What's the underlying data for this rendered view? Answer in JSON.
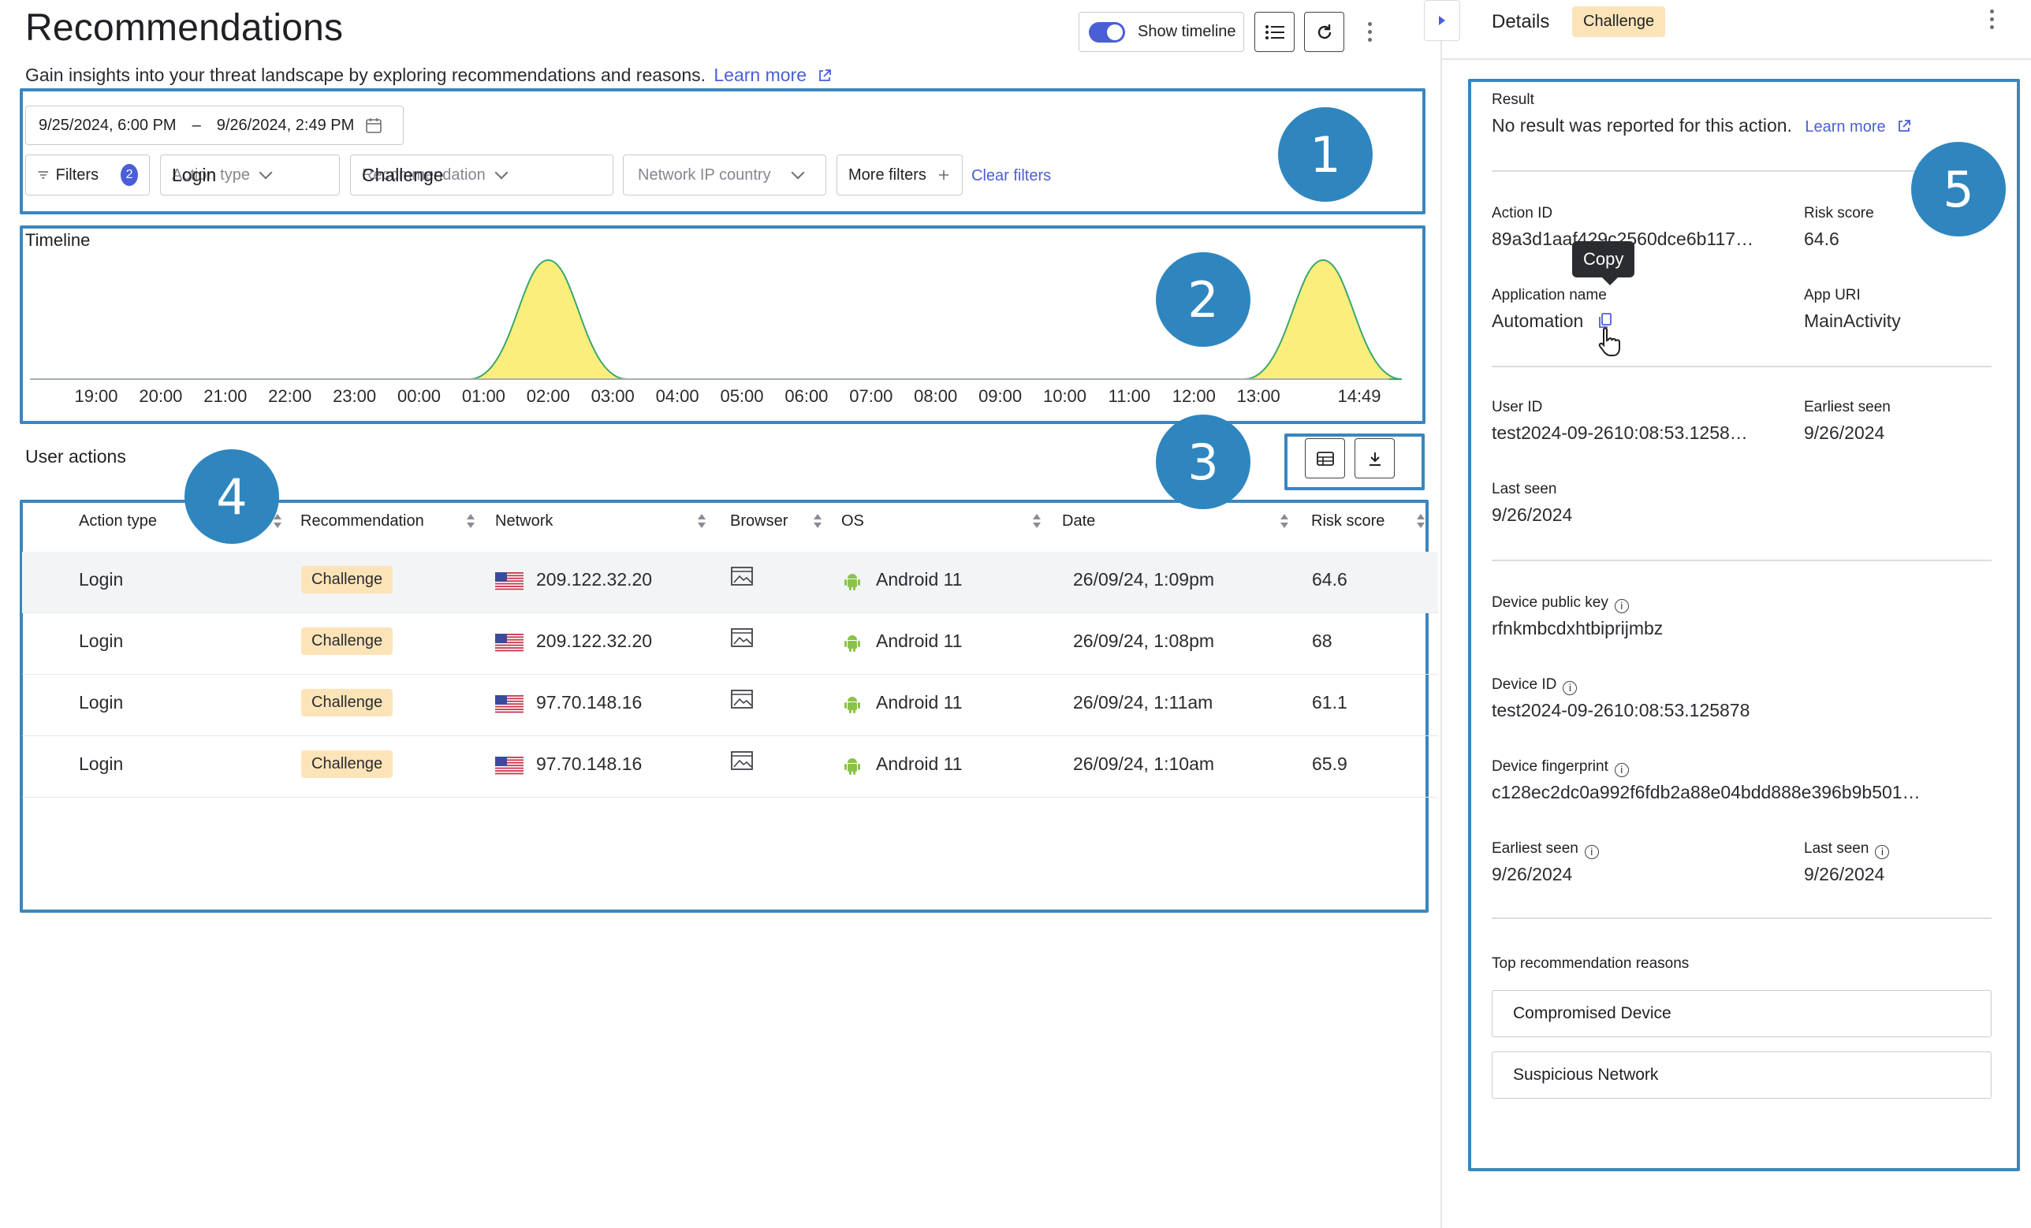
{
  "header": {
    "title": "Recommendations",
    "subtitle": "Gain insights into your threat landscape by exploring recommendations and reasons.",
    "learn_more": "Learn more",
    "show_timeline_label": "Show timeline",
    "show_timeline_on": true
  },
  "filters": {
    "date_start": "9/25/2024, 6:00 PM",
    "date_separator": "–",
    "date_end": "9/26/2024, 2:49 PM",
    "filters_label": "Filters",
    "filters_count": "2",
    "action_type_label": "Action type",
    "action_type_value": "Login",
    "recommendation_label": "Recommendation",
    "recommendation_value": "Challenge",
    "network_ip_country_label": "Network IP country",
    "more_filters_label": "More filters",
    "clear_filters_label": "Clear filters"
  },
  "timeline": {
    "title": "Timeline",
    "ticks": [
      "19:00",
      "20:00",
      "21:00",
      "22:00",
      "23:00",
      "00:00",
      "01:00",
      "02:00",
      "03:00",
      "04:00",
      "05:00",
      "06:00",
      "07:00",
      "08:00",
      "09:00",
      "10:00",
      "11:00",
      "12:00",
      "13:00",
      "14:49"
    ]
  },
  "chart_data": {
    "type": "area",
    "title": "Timeline",
    "x": [
      "19:00",
      "20:00",
      "21:00",
      "22:00",
      "23:00",
      "00:00",
      "01:00",
      "02:00",
      "03:00",
      "04:00",
      "05:00",
      "06:00",
      "07:00",
      "08:00",
      "09:00",
      "10:00",
      "11:00",
      "12:00",
      "13:00",
      "14:00",
      "14:49"
    ],
    "series": [
      {
        "values": [
          0,
          0,
          0,
          0,
          0,
          0,
          0,
          4,
          0,
          0,
          0,
          0,
          0,
          0,
          0,
          0,
          0,
          0,
          0,
          4,
          0
        ]
      }
    ],
    "grid": false,
    "fill_color": "#fcee7c",
    "line_color": "#3aa76d"
  },
  "user_actions": {
    "title": "User actions",
    "columns": [
      "Action type",
      "Recommendation",
      "Network",
      "Browser",
      "OS",
      "Date",
      "Risk score"
    ],
    "rows": [
      {
        "action": "Login",
        "recommendation": "Challenge",
        "network": "209.122.32.20",
        "os": "Android 11",
        "date": "26/09/24, 1:09pm",
        "risk": "64.6"
      },
      {
        "action": "Login",
        "recommendation": "Challenge",
        "network": "209.122.32.20",
        "os": "Android 11",
        "date": "26/09/24, 1:08pm",
        "risk": "68"
      },
      {
        "action": "Login",
        "recommendation": "Challenge",
        "network": "97.70.148.16",
        "os": "Android 11",
        "date": "26/09/24, 1:11am",
        "risk": "61.1"
      },
      {
        "action": "Login",
        "recommendation": "Challenge",
        "network": "97.70.148.16",
        "os": "Android 11",
        "date": "26/09/24, 1:10am",
        "risk": "65.9"
      }
    ]
  },
  "details": {
    "title": "Details",
    "badge": "Challenge",
    "result_label": "Result",
    "result_value": "No result was reported for this action.",
    "learn_more": "Learn more",
    "action_id_label": "Action ID",
    "action_id_value": "89a3d1aaf429c2560dce6b117…",
    "risk_score_label": "Risk score",
    "risk_score_value": "64.6",
    "copy_tooltip": "Copy",
    "application_name_label": "Application name",
    "application_name_value": "Automation",
    "app_uri_label": "App URI",
    "app_uri_value": "MainActivity",
    "user_id_label": "User ID",
    "user_id_value": "test2024-09-2610:08:53.1258…",
    "earliest_seen_label": "Earliest seen",
    "earliest_seen_value": "9/26/2024",
    "last_seen_label": "Last seen",
    "last_seen_value": "9/26/2024",
    "device_public_key_label": "Device public key",
    "device_public_key_value": "rfnkmbcdxhtbiprijmbz",
    "device_id_label": "Device ID",
    "device_id_value": "test2024-09-2610:08:53.125878",
    "device_fingerprint_label": "Device fingerprint",
    "device_fingerprint_value": "c128ec2dc0a992f6fdb2a88e04bdd888e396b9b501…",
    "device_earliest_seen_label": "Earliest seen",
    "device_earliest_seen_value": "9/26/2024",
    "device_last_seen_label": "Last seen",
    "device_last_seen_value": "9/26/2024",
    "top_reasons_label": "Top recommendation reasons",
    "reasons": [
      "Compromised Device",
      "Suspicious Network"
    ]
  },
  "callouts": [
    "1",
    "2",
    "3",
    "4",
    "5"
  ]
}
